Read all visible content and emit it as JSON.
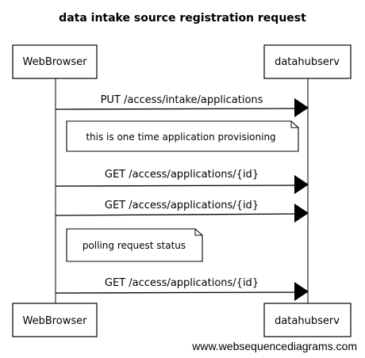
{
  "diagram": {
    "title": "data intake source registration request",
    "participants": [
      {
        "id": "client",
        "label": "WebBrowser"
      },
      {
        "id": "server",
        "label": "datahubserv"
      }
    ],
    "messages": [
      {
        "label": "PUT /access/intake/applications",
        "from": "client",
        "to": "server"
      },
      {
        "label": "GET /access/applications/{id}",
        "from": "client",
        "to": "server"
      },
      {
        "label": "GET /access/applications/{id}",
        "from": "client",
        "to": "server"
      },
      {
        "label": "GET /access/applications/{id}",
        "from": "client",
        "to": "server"
      }
    ],
    "notes": [
      {
        "text": "this is one time application provisioning"
      },
      {
        "text": "polling request status"
      }
    ],
    "footer": "www.websequencediagrams.com"
  }
}
